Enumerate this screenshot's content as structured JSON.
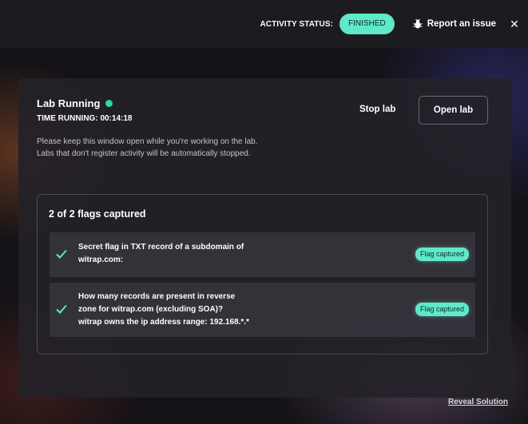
{
  "topbar": {
    "status_label": "ACTIVITY STATUS:",
    "status_value": "FINISHED",
    "report_label": "Report an issue",
    "close_glyph": "✕",
    "bug_icon": "bug-icon",
    "accent": "#5fe8c9"
  },
  "lab": {
    "title": "Lab Running",
    "status_dot_color": "#2fd8a0",
    "time_running": "TIME RUNNING: 00:14:18",
    "note_line1": "Please keep this window open while you're working on the lab.",
    "note_line2": "Labs that don't register activity will be automatically stopped.",
    "stop_label": "Stop lab",
    "open_label": "Open lab"
  },
  "flags": {
    "count_label": "2 of 2 flags captured",
    "items": [
      {
        "lines": [
          "Secret flag in TXT record of a subdomain of",
          "witrap.com:"
        ],
        "status": "Flag captured"
      },
      {
        "lines": [
          "How many records are present in reverse",
          "zone for witrap.com (excluding SOA)?",
          "witrap owns the ip address range: 192.168.*.*"
        ],
        "status": "Flag captured"
      }
    ]
  },
  "footer": {
    "reveal_label": "Reveal Solution"
  }
}
